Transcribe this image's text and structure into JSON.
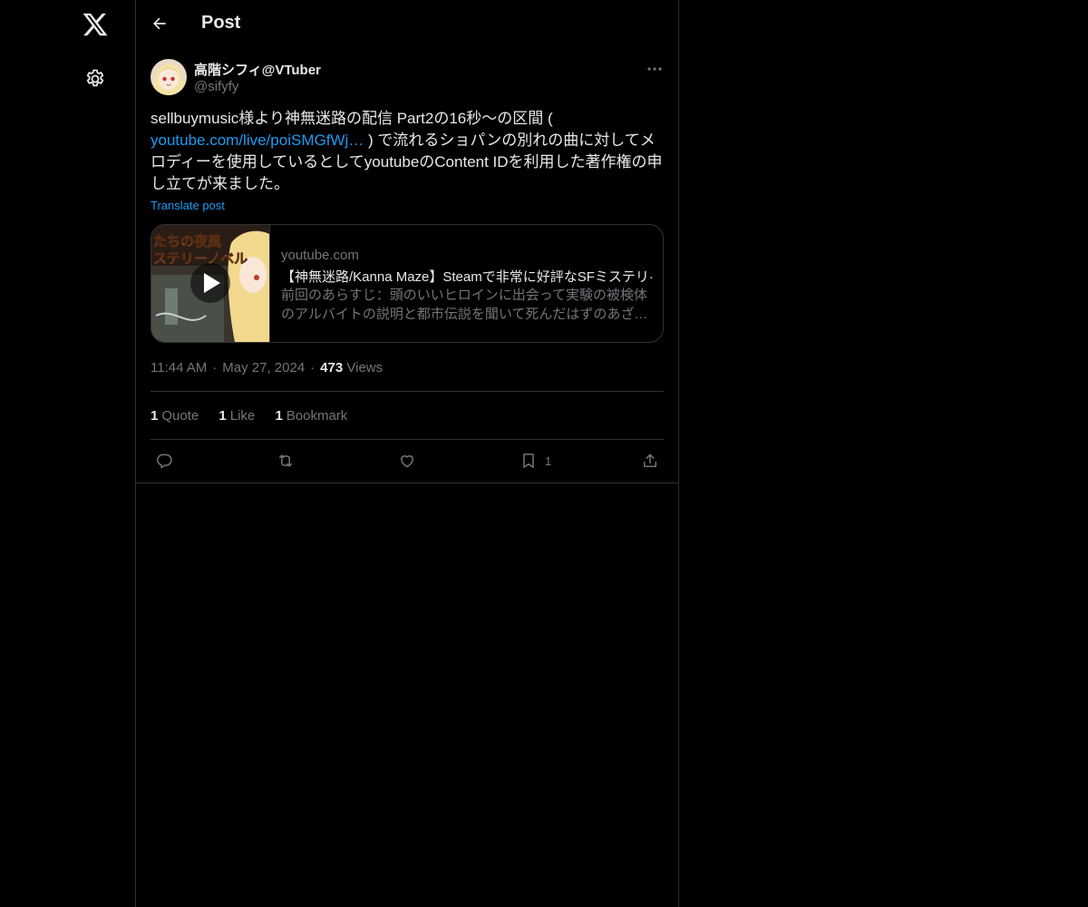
{
  "header": {
    "title": "Post",
    "back_icon": "arrow-left-icon"
  },
  "rail": {
    "logo_icon": "x-logo-icon",
    "settings_icon": "gear-icon"
  },
  "post": {
    "display_name": "高階シフィ@VTuber",
    "handle": "@sifyfy",
    "text_before": "sellbuymusic様より神無迷路の配信 Part2の16秒〜の区間 ( ",
    "link_text": "youtube.com/live/poiSMGfWj…",
    "text_after": " ) で流れるショパンの別れの曲に対してメロディーを使用しているとしてyoutubeのContent IDを利用した著作権の申し立てが来ました。",
    "translate_label": "Translate post",
    "card": {
      "domain": "youtube.com",
      "title": "【神無迷路/Kanna Maze】Steamで非常に好評なSFミステリ·",
      "desc_line1": "前回のあらすじ：頭のいいヒロインに出会って実験の被検体",
      "desc_line2": "のアルバイトの説明と都市伝説を聞いて死んだはずのあざ…",
      "thumb_text_top": "たちの夜風",
      "thumb_text_mid": "ステリーノベル"
    },
    "time": "11:44 AM",
    "date": "May 27, 2024",
    "views_count": "473",
    "views_label": "Views",
    "stats": {
      "quote_count": "1",
      "quote_label": "Quote",
      "like_count": "1",
      "like_label": "Like",
      "bookmark_count": "1",
      "bookmark_label": "Bookmark"
    },
    "actions": {
      "reply_icon": "reply-icon",
      "repost_icon": "repost-icon",
      "like_icon": "heart-icon",
      "bookmark_icon": "bookmark-icon",
      "bookmark_count": "1",
      "share_icon": "share-icon"
    }
  },
  "colors": {
    "background": "#000000",
    "text": "#e7e9ea",
    "secondary": "#71767b",
    "link": "#1d9bf0",
    "border": "#2f3336"
  }
}
